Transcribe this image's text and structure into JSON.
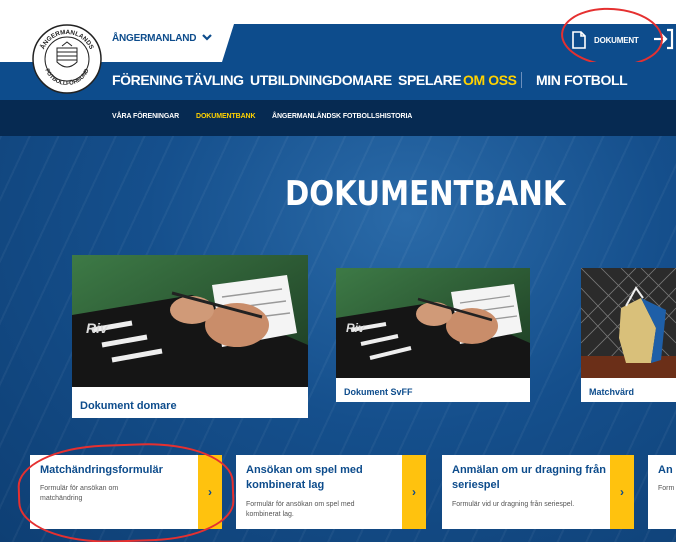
{
  "header": {
    "district": "ÅNGERMANLAND",
    "document_link": "DOKUMENT",
    "logo_text_top": "ÅNGERMANLANDS",
    "logo_text_bottom": "FOTBOLLFÖRBUND",
    "logo_icon": "crest-logo-icon",
    "login_icon": "login-icon"
  },
  "main_nav": [
    "FÖRENING",
    "TÄVLING",
    "UTBILDNING",
    "DOMARE",
    "SPELARE",
    "OM OSS",
    "MIN FOTBOLL"
  ],
  "main_nav_active": "OM OSS",
  "sub_nav": [
    "VÅRA FÖRENINGAR",
    "DOKUMENTBANK",
    "ÅNGERMANLÄNDSK FOTBOLLSHISTORIA"
  ],
  "sub_nav_active": "DOKUMENTBANK",
  "hero": {
    "title": "DOKUMENTBANK"
  },
  "cards": [
    {
      "label": "Dokument domare"
    },
    {
      "label": "Dokument SvFF"
    },
    {
      "label": "Matchvärd"
    }
  ],
  "forms": [
    {
      "title": "Matchändringsformulär",
      "desc": "Formulär för ansökan om matchändring"
    },
    {
      "title": "Ansökan om spel med kombinerat lag",
      "desc": "Formulär för ansökan om spel med kombinerat lag."
    },
    {
      "title": "Anmälan om ur dragning från seriespel",
      "desc": "Formulär vid ur dragning från seriespel."
    },
    {
      "title": "An",
      "desc": "Form"
    }
  ],
  "colors": {
    "brand_blue": "#0d4c8c",
    "dark_blue": "#062a52",
    "accent_yellow": "#ffd200",
    "arrow_yellow": "#ffc20e",
    "annotation_red": "#e53030"
  }
}
